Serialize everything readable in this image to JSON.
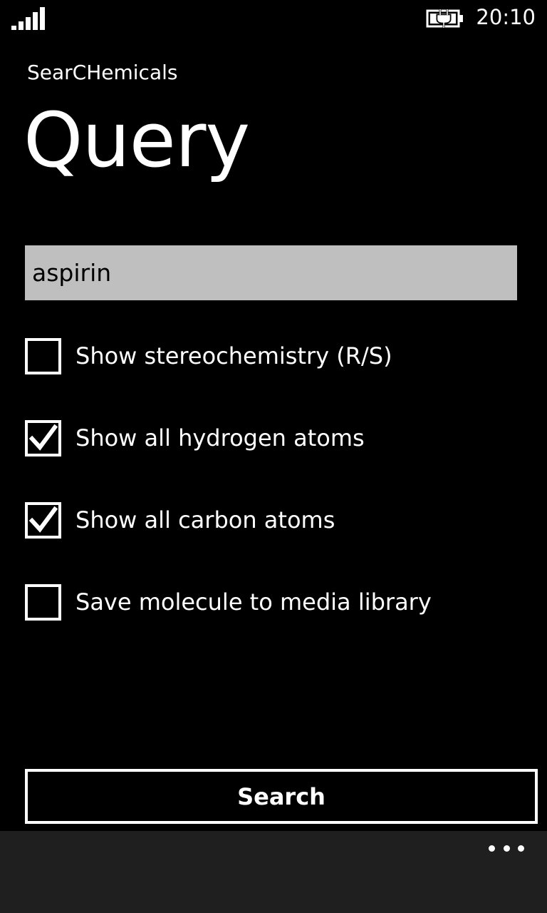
{
  "status_bar": {
    "time": "20:10",
    "signal_icon": "signal-strength-icon",
    "battery_icon": "battery-charging-icon"
  },
  "header": {
    "app_name": "SearCHemicals",
    "page_title": "Query"
  },
  "query": {
    "value": "aspirin"
  },
  "options": [
    {
      "label": "Show stereochemistry (R/S)",
      "checked": false
    },
    {
      "label": "Show all hydrogen atoms",
      "checked": true
    },
    {
      "label": "Show all carbon atoms",
      "checked": true
    },
    {
      "label": "Save molecule to media library",
      "checked": false
    }
  ],
  "search_button": {
    "label": "Search"
  },
  "app_bar": {
    "more_icon": "ellipsis-icon"
  },
  "colors": {
    "background": "#000000",
    "foreground": "#ffffff",
    "textbox_background": "#bfbfbf",
    "app_bar_background": "#1f1f1f"
  }
}
